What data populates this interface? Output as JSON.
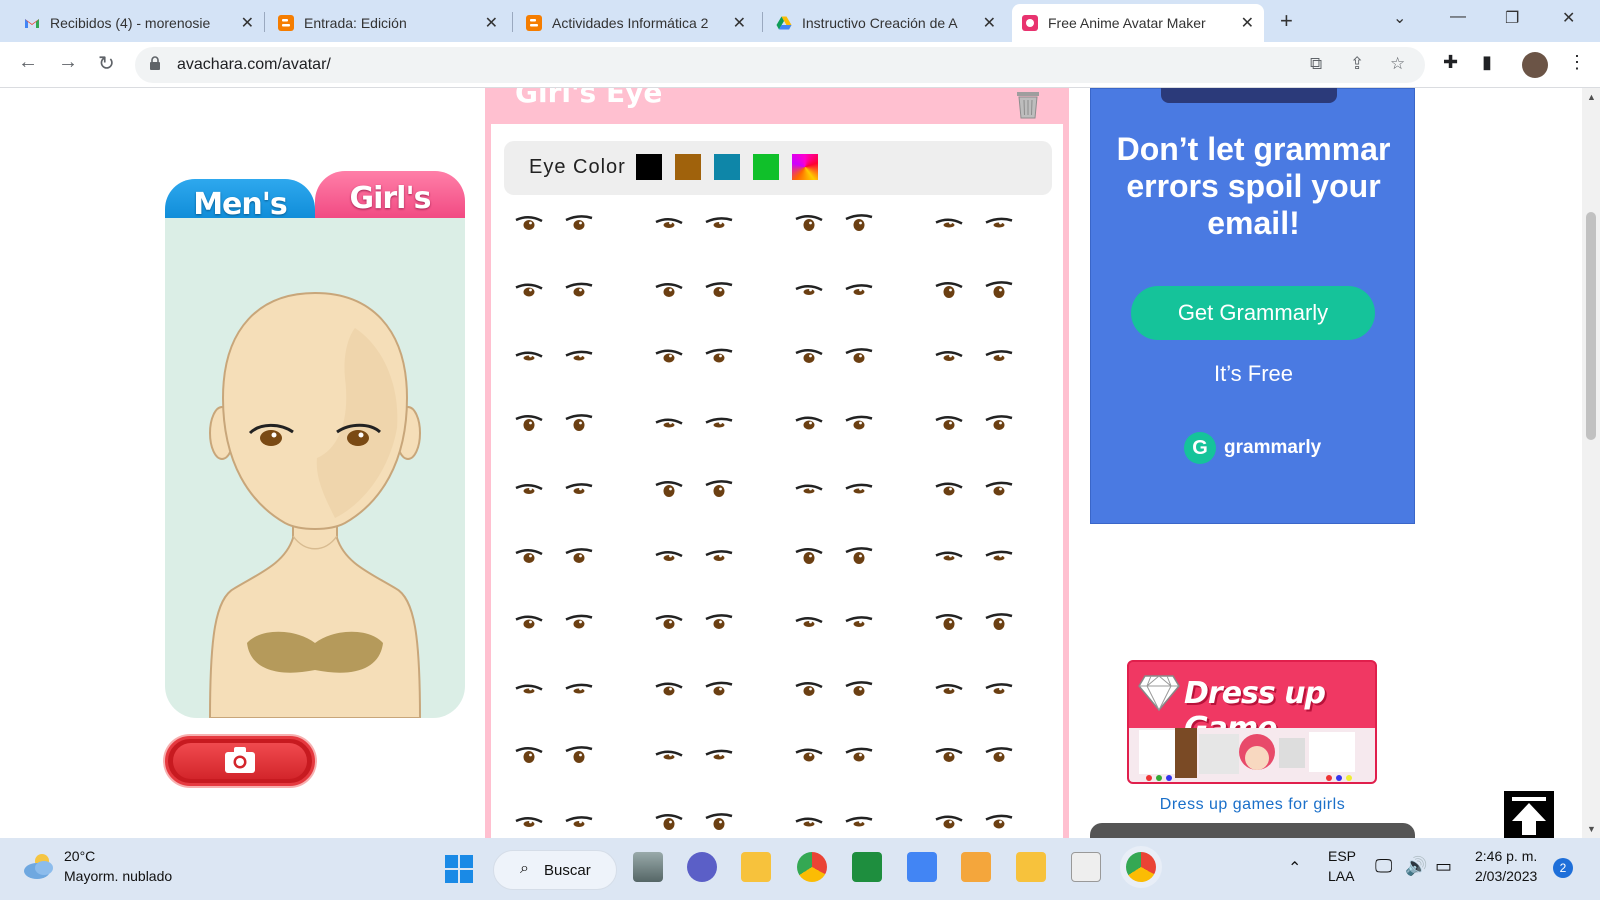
{
  "browser": {
    "tabs": [
      {
        "title": "Recibidos (4) - morenosie",
        "favicon": "gmail-icon",
        "active": false
      },
      {
        "title": "Entrada: Edición",
        "favicon": "blogger-icon",
        "active": false
      },
      {
        "title": "Actividades Informática 2",
        "favicon": "blogger-icon",
        "active": false
      },
      {
        "title": "Instructivo Creación de A",
        "favicon": "google-drive-icon",
        "active": false
      },
      {
        "title": "Free Anime Avatar Maker",
        "favicon": "avachara-icon",
        "active": true
      }
    ],
    "url": "avachara.com/avatar/"
  },
  "avatar_maker": {
    "tab_men": "Men's",
    "tab_girl": "Girl's",
    "panel_title": "Girl's Eye",
    "eye_color_label": "Eye Color",
    "eye_colors": [
      "#000000",
      "#a0620c",
      "#0e86a8",
      "#10c02a",
      "rainbow"
    ]
  },
  "ads": {
    "grammarly": {
      "headline": "Don’t let grammar errors spoil your email!",
      "button": "Get Grammarly",
      "free": "It’s Free",
      "brand": "grammarly"
    },
    "dress_up": {
      "title": "Dress up Game",
      "link": "Dress up games for girls"
    }
  },
  "taskbar": {
    "temp": "20°C",
    "weather": "Mayorm. nublado",
    "search": "Buscar",
    "lang1": "ESP",
    "lang2": "LAA",
    "time": "2:46 p. m.",
    "date": "2/03/2023",
    "notifications": "2"
  }
}
